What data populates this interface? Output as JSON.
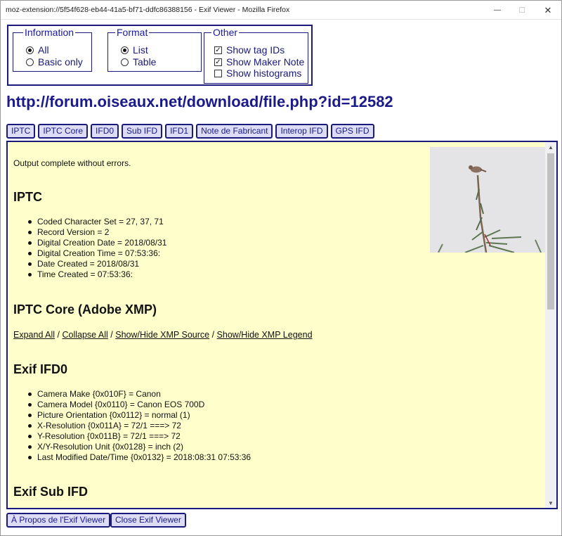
{
  "window": {
    "title": "moz-extension://5f54f628-eb44-41a5-bf71-ddfc86388156 - Exif Viewer - Mozilla Firefox",
    "controls": {
      "minimize": "—",
      "maximize": "☐",
      "close": "✕"
    }
  },
  "options": {
    "information": {
      "legend": "Information",
      "items": [
        {
          "label": "All",
          "checked": true
        },
        {
          "label": "Basic only",
          "checked": false
        }
      ]
    },
    "format": {
      "legend": "Format",
      "items": [
        {
          "label": "List",
          "checked": true
        },
        {
          "label": "Table",
          "checked": false
        }
      ]
    },
    "other": {
      "legend": "Other",
      "items": [
        {
          "label": "Show tag IDs",
          "checked": true
        },
        {
          "label": "Show Maker Note",
          "checked": true
        },
        {
          "label": "Show histograms",
          "checked": false
        }
      ]
    }
  },
  "url": "http://forum.oiseaux.net/download/file.php?id=12582",
  "tabs": [
    "IPTC",
    "IPTC Core",
    "IFD0",
    "Sub IFD",
    "IFD1",
    "Note de Fabricant",
    "Interop IFD",
    "GPS IFD"
  ],
  "content": {
    "status": "Output complete without errors.",
    "iptc": {
      "heading": "IPTC",
      "items": [
        "Coded Character Set = 27, 37, 71",
        "Record Version = 2",
        "Digital Creation Date = 2018/08/31",
        "Digital Creation Time = 07:53:36:",
        "Date Created = 2018/08/31",
        "Time Created = 07:53:36:"
      ]
    },
    "iptc_core": {
      "heading": "IPTC Core (Adobe XMP)",
      "links": [
        "Expand All",
        "Collapse All",
        "Show/Hide XMP Source",
        "Show/Hide XMP Legend"
      ],
      "separator": " / "
    },
    "ifd0": {
      "heading": "Exif IFD0",
      "items": [
        "Camera Make {0x010F} = Canon",
        "Camera Model {0x0110} = Canon EOS 700D",
        "Picture Orientation {0x0112} = normal (1)",
        "X-Resolution {0x011A} = 72/1 ===> 72",
        "Y-Resolution {0x011B} = 72/1 ===> 72",
        "X/Y-Resolution Unit {0x0128} = inch (2)",
        "Last Modified Date/Time {0x0132} = 2018:08:31 07:53:36"
      ]
    },
    "sub_ifd": {
      "heading": "Exif Sub IFD"
    }
  },
  "buttons": {
    "about": "À Propos de l'Exif Viewer",
    "close": "Close Exif Viewer"
  },
  "colors": {
    "accent": "#1a1a7a",
    "content_bg": "#ffffcc",
    "button_bg": "#dcdcf6"
  }
}
